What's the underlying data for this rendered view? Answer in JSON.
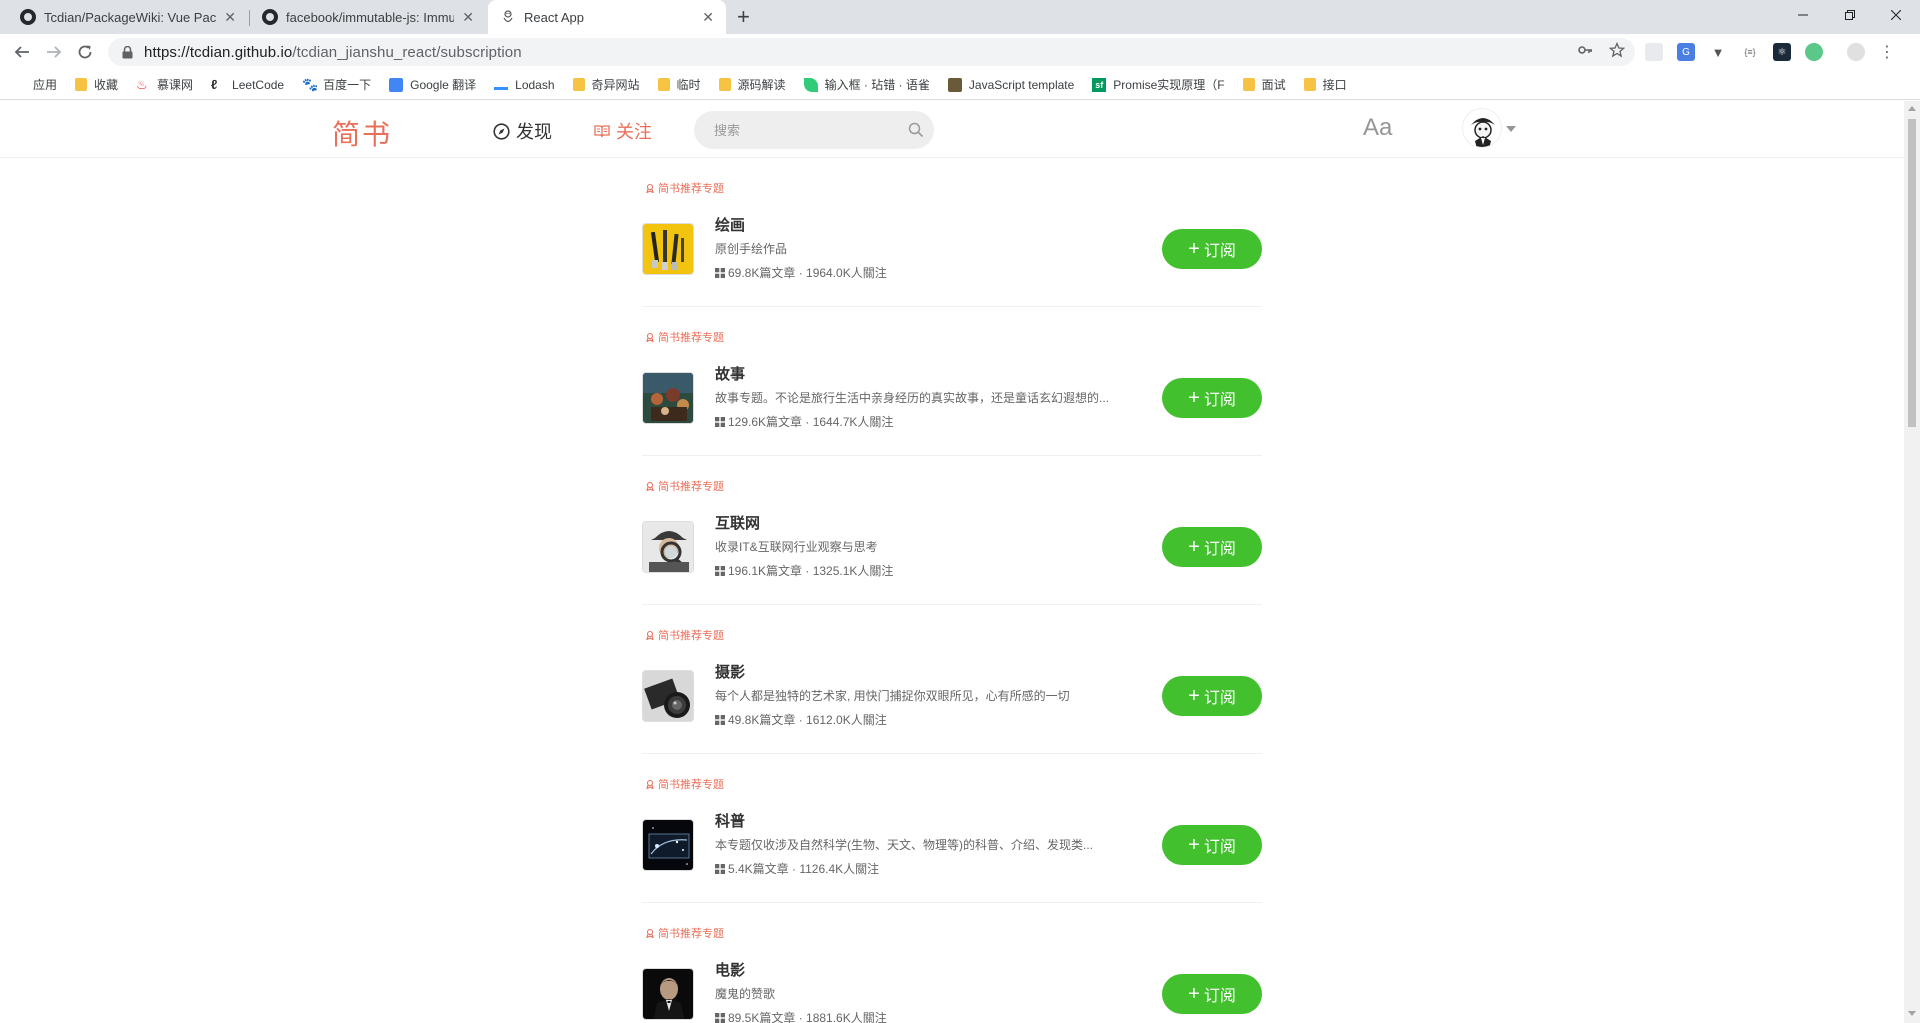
{
  "browser": {
    "tabs": [
      {
        "title": "Tcdian/PackageWiki: Vue Pack",
        "favicon": "github-icon",
        "active": false
      },
      {
        "title": "facebook/immutable-js: Immu",
        "favicon": "github-icon",
        "active": false
      },
      {
        "title": "React App",
        "favicon": "react-app-icon",
        "active": true
      }
    ],
    "url_host": "https://tcdian.github.io",
    "url_path": "/tcdian_jianshu_react/subscription",
    "bookmarks": [
      {
        "label": "应用",
        "icon": "apps-grid-icon"
      },
      {
        "label": "收藏",
        "icon": "folder-icon"
      },
      {
        "label": "慕课网",
        "icon": "imooc-icon"
      },
      {
        "label": "LeetCode",
        "icon": "leetcode-icon"
      },
      {
        "label": "百度一下",
        "icon": "baidu-icon"
      },
      {
        "label": "Google 翻译",
        "icon": "google-translate-icon"
      },
      {
        "label": "Lodash",
        "icon": "lodash-icon"
      },
      {
        "label": "奇异网站",
        "icon": "folder-icon"
      },
      {
        "label": "临时",
        "icon": "folder-icon"
      },
      {
        "label": "源码解读",
        "icon": "folder-icon"
      },
      {
        "label": "输入框 · 玷错 · 语雀",
        "icon": "yuque-icon"
      },
      {
        "label": "JavaScript template",
        "icon": "js-template-icon"
      },
      {
        "label": "Promise实现原理（F",
        "icon": "segmentfault-icon"
      },
      {
        "label": "面试",
        "icon": "folder-icon"
      },
      {
        "label": "接口",
        "icon": "folder-icon"
      }
    ]
  },
  "header": {
    "logo": "简书",
    "nav_discover": "发现",
    "nav_follow": "关注",
    "search_placeholder": "搜索",
    "font_toggle": "Aa"
  },
  "list": {
    "recommend_label": "简书推荐专题",
    "subscribe_label": "订阅",
    "items": [
      {
        "title": "绘画",
        "desc": "原创手绘作品",
        "meta": "69.8K篇文章 · 1964.0K人關注",
        "thumb": "paintbrushes-image"
      },
      {
        "title": "故事",
        "desc": "故事专题。不论是旅行生活中亲身经历的真实故事，还是童话玄幻遐想的...",
        "meta": "129.6K篇文章 · 1644.7K人關注",
        "thumb": "painting-image"
      },
      {
        "title": "互联网",
        "desc": "收录IT&互联网行业观察与思考",
        "meta": "196.1K篇文章 · 1325.1K人關注",
        "thumb": "detective-image"
      },
      {
        "title": "摄影",
        "desc": "每个人都是独特的艺术家, 用快门捕捉你双眼所见，心有所感的一切",
        "meta": "49.8K篇文章 · 1612.0K人關注",
        "thumb": "camera-lens-image"
      },
      {
        "title": "科普",
        "desc": "本专题仅收涉及自然科学(生物、天文、物理等)的科普、介绍、发现类...",
        "meta": "5.4K篇文章 · 1126.4K人關注",
        "thumb": "space-image"
      },
      {
        "title": "电影",
        "desc": "魔鬼的赞歌",
        "meta": "89.5K篇文章 · 1881.6K人關注",
        "thumb": "godfather-image"
      }
    ]
  },
  "colors": {
    "brand": "#ea6f5a",
    "subscribe_green": "#42c02e",
    "tab_bar": "#dee1e6"
  }
}
